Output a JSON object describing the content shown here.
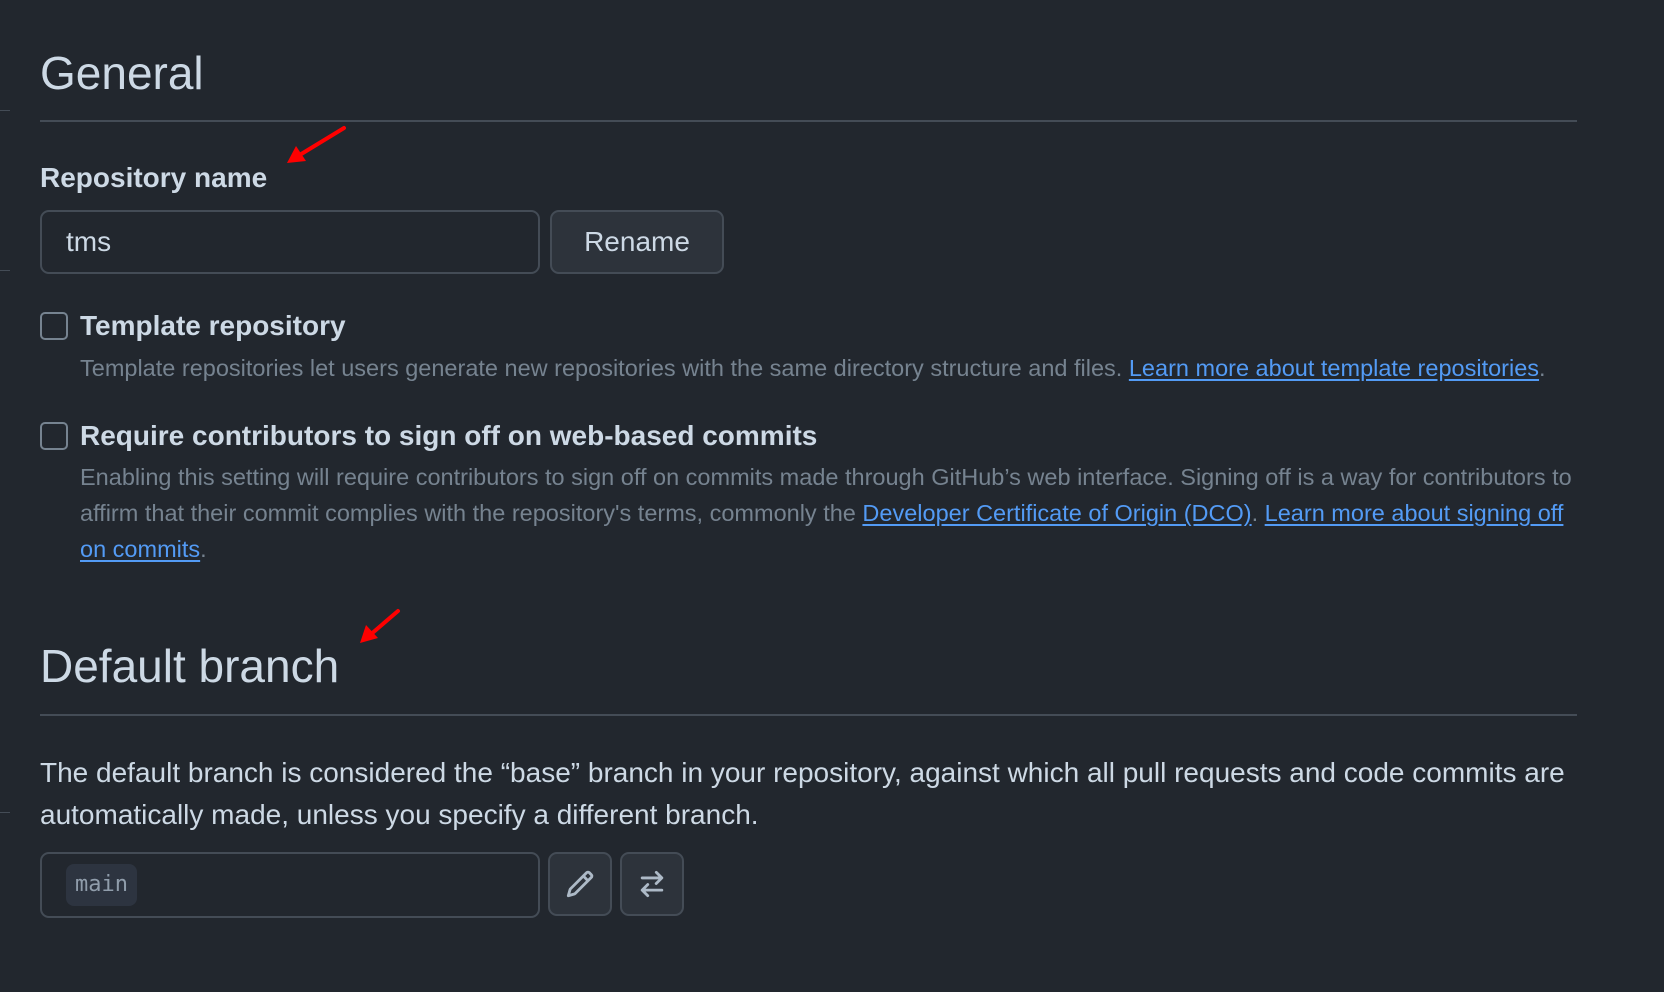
{
  "general": {
    "title": "General",
    "repo_name_label": "Repository name",
    "repo_name_value": "tms",
    "rename_button": "Rename",
    "template_repo": {
      "checked": false,
      "title": "Template repository",
      "desc_text": "Template repositories let users generate new repositories with the same directory structure and files.",
      "link_text": "Learn more about template repositories",
      "trailing": "."
    },
    "signoff": {
      "checked": false,
      "title": "Require contributors to sign off on web-based commits",
      "desc_text": "Enabling this setting will require contributors to sign off on commits made through GitHub’s web interface. Signing off is a way for contributors to affirm that their commit complies with the repository's terms, commonly the",
      "dco_link": "Developer Certificate of Origin (DCO)",
      "mid_text": ".",
      "learn_link": "Learn more about signing off on commits",
      "trailing": "."
    }
  },
  "default_branch": {
    "title": "Default branch",
    "description": "The default branch is considered the “base” branch in your repository, against which all pull requests and code commits are automatically made, unless you specify a different branch.",
    "branch_name": "main",
    "edit_icon": "pencil-icon",
    "switch_icon": "arrow-switch-icon"
  },
  "colors": {
    "background": "#22272e",
    "link": "#539bf5",
    "annotation_arrow": "#ff0000"
  }
}
